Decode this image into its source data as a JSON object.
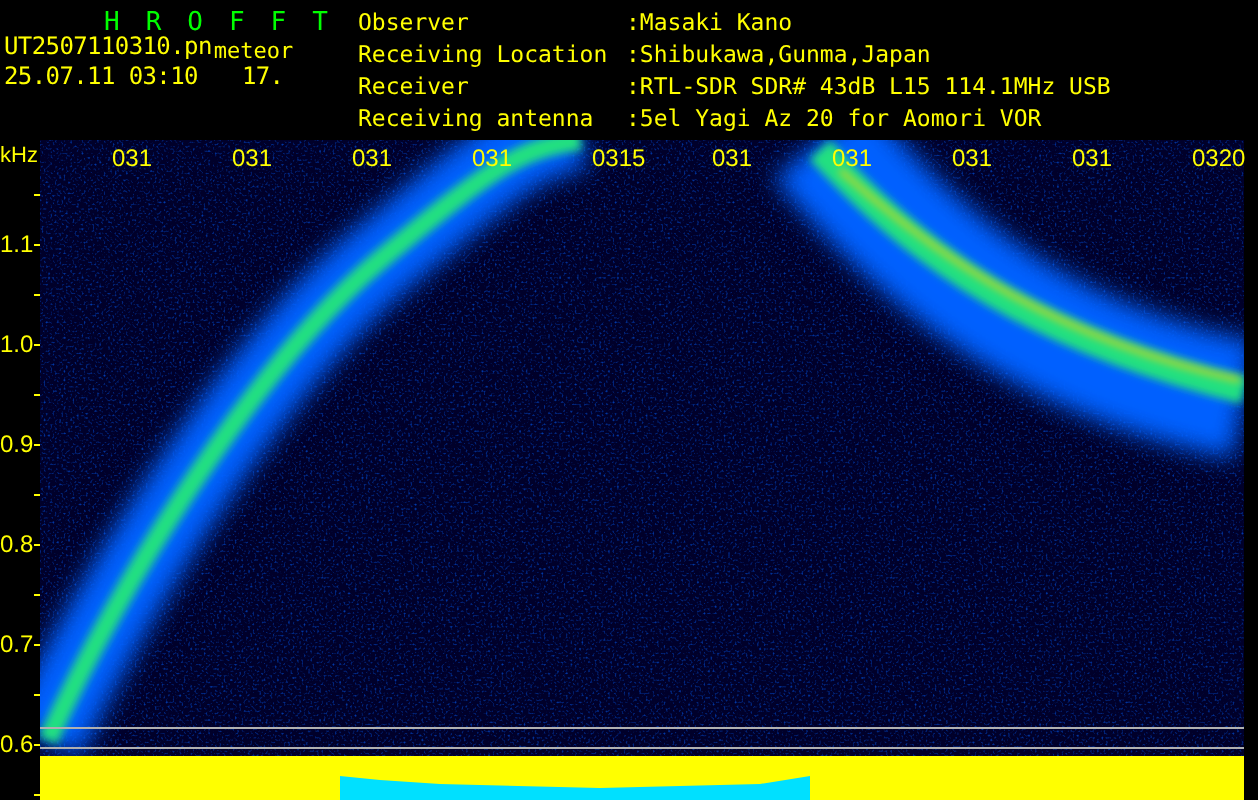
{
  "header": {
    "title": "HROFFT",
    "filename": "UT2507110310.pn",
    "tag": "meteor",
    "datetime": "25.07.11 03:10",
    "count": "17.",
    "info": [
      {
        "label": "Observer",
        "value": ":Masaki Kano"
      },
      {
        "label": "Receiving Location",
        "value": ":Shibukawa,Gunma,Japan"
      },
      {
        "label": "Receiver",
        "value": ":RTL-SDR SDR# 43dB L15 114.1MHz USB"
      },
      {
        "label": "Receiving antenna",
        "value": ":5el Yagi Az 20 for Aomori VOR"
      }
    ]
  },
  "plot": {
    "unit": "kHz",
    "time_labels": [
      "031",
      "031",
      "031",
      "031",
      "0315",
      "031",
      "031",
      "031",
      "031",
      "0320"
    ],
    "freq_labels": [
      "1.1",
      "1.0",
      "0.9",
      "0.8",
      "0.7",
      "0.6"
    ]
  }
}
